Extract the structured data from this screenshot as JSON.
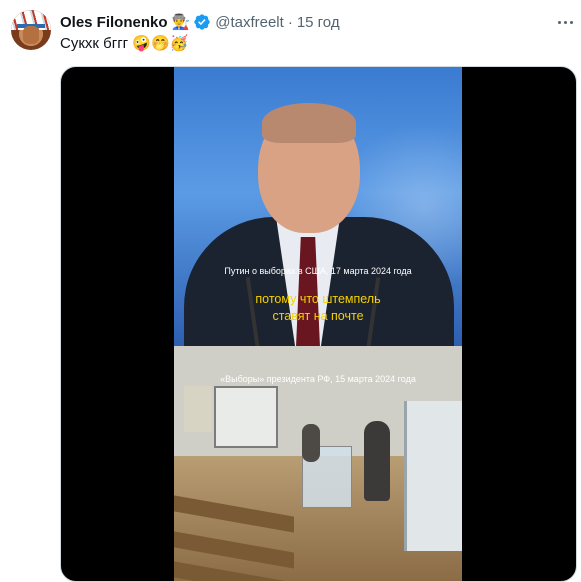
{
  "author": {
    "name": "Oles Filonenko",
    "name_emoji": "👨‍🏭",
    "handle": "@taxfreelt",
    "separator": "·",
    "time": "15 год"
  },
  "tweet": {
    "text": "Сукхк бггг 🤪🤭🥳"
  },
  "media": {
    "top_caption": "Путин о выборах в США, 17 марта 2024 года",
    "subtitle_line1": "потому что штемпель",
    "subtitle_line2": "ставят на почте",
    "bottom_caption": "«Выборы» президента РФ, 15 марта 2024 года"
  },
  "icons": {
    "verified": "verified-badge-icon",
    "more": "more-dots-icon"
  },
  "colors": {
    "verified": "#1d9bf0",
    "subtitle": "#f5d200",
    "secondary_text": "#536471"
  }
}
